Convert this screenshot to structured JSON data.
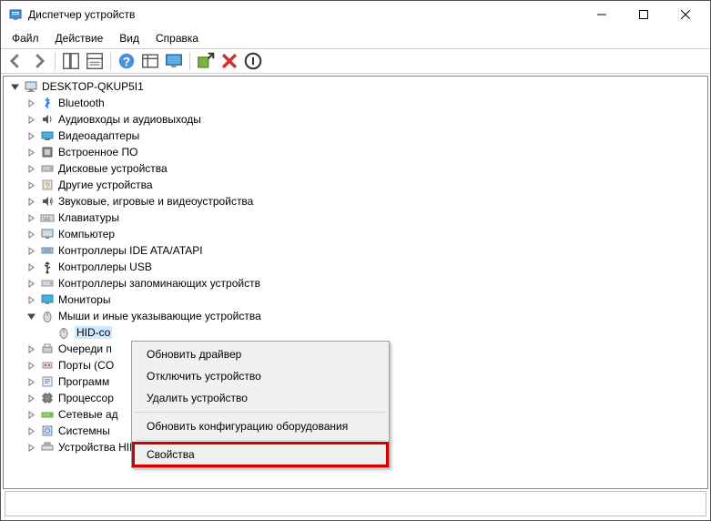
{
  "window": {
    "title": "Диспетчер устройств"
  },
  "menu": {
    "file": "Файл",
    "action": "Действие",
    "view": "Вид",
    "help": "Справка"
  },
  "tree": {
    "root": "DESKTOP-QKUP5I1",
    "items": [
      {
        "label": "Bluetooth",
        "icon": "bluetooth"
      },
      {
        "label": "Аудиовходы и аудиовыходы",
        "icon": "audio"
      },
      {
        "label": "Видеоадаптеры",
        "icon": "display-adapter"
      },
      {
        "label": "Встроенное ПО",
        "icon": "firmware"
      },
      {
        "label": "Дисковые устройства",
        "icon": "disk"
      },
      {
        "label": "Другие устройства",
        "icon": "other"
      },
      {
        "label": "Звуковые, игровые и видеоустройства",
        "icon": "sound"
      },
      {
        "label": "Клавиатуры",
        "icon": "keyboard"
      },
      {
        "label": "Компьютер",
        "icon": "computer"
      },
      {
        "label": "Контроллеры IDE ATA/ATAPI",
        "icon": "ide"
      },
      {
        "label": "Контроллеры USB",
        "icon": "usb"
      },
      {
        "label": "Контроллеры запоминающих устройств",
        "icon": "storage"
      },
      {
        "label": "Мониторы",
        "icon": "monitor"
      },
      {
        "label": "Мыши и иные указывающие устройства",
        "icon": "mouse",
        "expanded": true,
        "children": [
          {
            "label": "HID-co",
            "icon": "mouse",
            "selected": true
          }
        ]
      },
      {
        "label": "Очереди п",
        "icon": "print-queue"
      },
      {
        "label": "Порты (CO",
        "icon": "port"
      },
      {
        "label": "Программ",
        "icon": "software"
      },
      {
        "label": "Процессор",
        "icon": "cpu"
      },
      {
        "label": "Сетевые ад",
        "icon": "network"
      },
      {
        "label": "Системны",
        "icon": "system"
      },
      {
        "label": "Устройства HID (Human Interface Devices)",
        "icon": "hid"
      }
    ]
  },
  "context_menu": {
    "update_driver": "Обновить драйвер",
    "disable": "Отключить устройство",
    "uninstall": "Удалить устройство",
    "scan": "Обновить конфигурацию оборудования",
    "properties": "Свойства"
  }
}
